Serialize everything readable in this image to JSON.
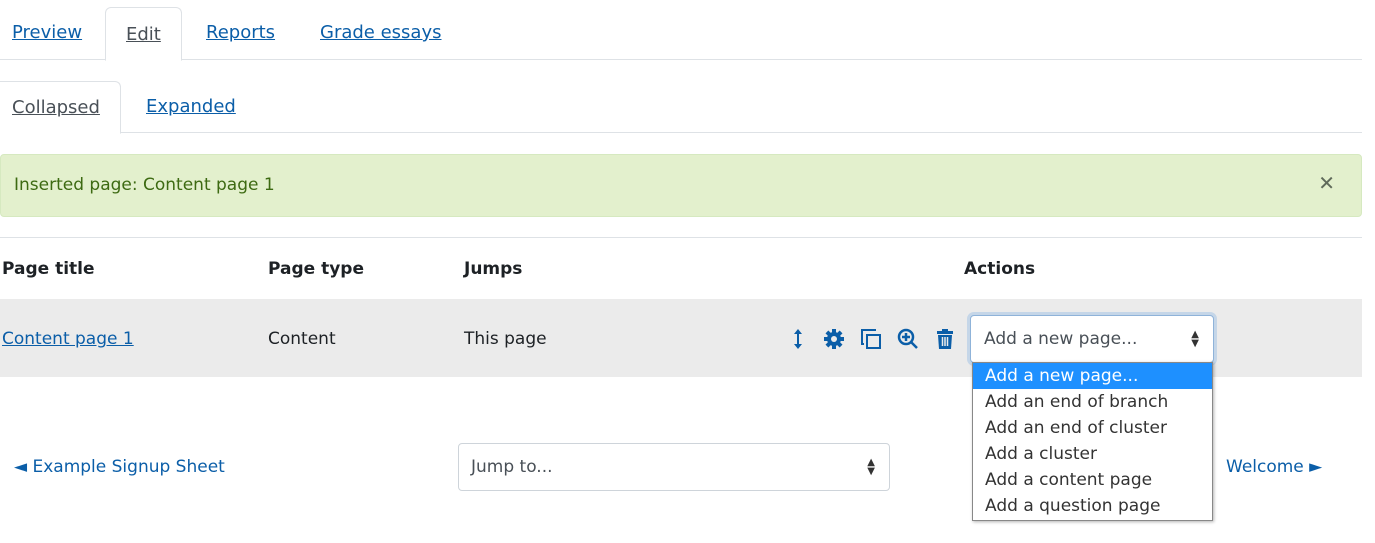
{
  "tabs": [
    {
      "label": "Preview"
    },
    {
      "label": "Edit",
      "active": true
    },
    {
      "label": "Reports"
    },
    {
      "label": "Grade essays"
    }
  ],
  "subtabs": [
    {
      "label": "Collapsed",
      "active": true
    },
    {
      "label": "Expanded"
    }
  ],
  "alert": {
    "message": "Inserted page: Content page 1",
    "close": "✕"
  },
  "table": {
    "headers": [
      "Page title",
      "Page type",
      "Jumps",
      "Actions"
    ],
    "rows": [
      {
        "title": "Content page 1",
        "type": "Content",
        "jumps": "This page"
      }
    ]
  },
  "row_actions": [
    "move-icon",
    "settings-icon",
    "duplicate-icon",
    "preview-icon",
    "delete-icon"
  ],
  "add_page_select": {
    "value": "Add a new page...",
    "options": [
      "Add a new page...",
      "Add an end of branch",
      "Add an end of cluster",
      "Add a cluster",
      "Add a content page",
      "Add a question page"
    ]
  },
  "nav": {
    "prev": "◄ Example Signup Sheet",
    "jump": "Jump to...",
    "next": "Welcome ►"
  },
  "colors": {
    "link": "#0b5ea8",
    "highlight": "#1e90ff",
    "alert_bg": "#e3f0cd"
  }
}
